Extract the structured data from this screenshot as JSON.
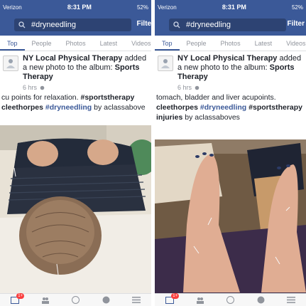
{
  "status": {
    "carrier": "Verizon",
    "time": "8:31 PM",
    "battery": "52%"
  },
  "search": {
    "value": "#dryneedling",
    "filter_label": "Filter"
  },
  "tabs": [
    "Top",
    "People",
    "Photos",
    "Latest",
    "Videos"
  ],
  "post": {
    "author": "NY Local Physical Therapy",
    "action": " added a new photo to the album: ",
    "album": "Sports Therapy",
    "time": "6 hrs",
    "privacy_icon": "globe-icon"
  },
  "left_caption": {
    "line1": "cu points for relaxation. ",
    "tag1": "#sportstherapy",
    "tag2": "cleethorpes",
    "hl": "#dryneedling",
    "by": " by aclassabove"
  },
  "right_caption": {
    "line1": "tomach, bladder and liver acupoints.",
    "tag1": "cleethorpes",
    "hl": "#dryneedling",
    "tag2": "#sportstherapy",
    "tag3": "injuries",
    "by": " by aclassaboves"
  },
  "tabbar": {
    "badge": "1+",
    "icons": [
      "news-feed-icon",
      "friends-icon",
      "messenger-icon",
      "globe-icon",
      "menu-icon"
    ]
  },
  "colors": {
    "brand": "#3b5998",
    "link": "#3b5998",
    "badge": "#fa3e3e"
  }
}
